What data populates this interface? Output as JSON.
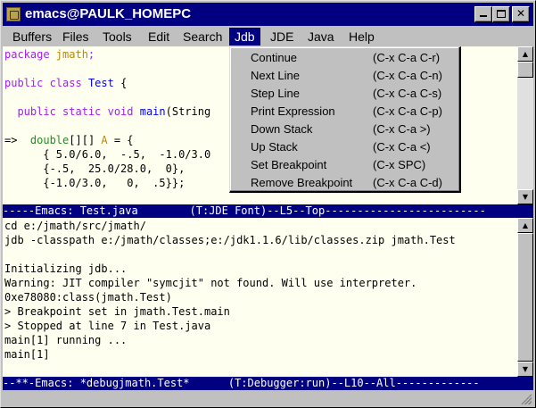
{
  "window": {
    "title": "emacs@PAULK_HOMEPC"
  },
  "menubar": {
    "items": [
      "Buffers",
      "Files",
      "Tools",
      "Edit",
      "Search",
      "Jdb",
      "JDE",
      "Java",
      "Help"
    ],
    "active": "Jdb"
  },
  "code_pane": {
    "lines": [
      "package jmath;",
      "",
      "public class Test {",
      "",
      "  public static void main(String",
      "",
      "=>  double[][] A = {",
      "      { 5.0/6.0,  -.5,  -1.0/3.0",
      "      {-.5,  25.0/28.0,  0},",
      "      {-1.0/3.0,   0,  .5}};"
    ]
  },
  "modeline_top": {
    "text": "-----Emacs: Test.java        (T:JDE Font)--L5--Top-------------------------"
  },
  "debug_pane": {
    "lines": [
      "cd e:/jmath/src/jmath/",
      "jdb -classpath e:/jmath/classes;e:/jdk1.1.6/lib/classes.zip jmath.Test",
      "",
      "Initializing jdb...",
      "Warning: JIT compiler \"symcjit\" not found. Will use interpreter.",
      "0xe78080:class(jmath.Test)",
      "> Breakpoint set in jmath.Test.main",
      "> Stopped at line 7 in Test.java",
      "main[1] running ...",
      "main[1]"
    ]
  },
  "modeline_bottom": {
    "text": "--**-Emacs: *debugjmath.Test*      (T:Debugger:run)--L10--All-------------"
  },
  "jdb_menu": {
    "items": [
      {
        "label": "Continue",
        "shortcut": "(C-x C-a C-r)"
      },
      {
        "label": "Next Line",
        "shortcut": "(C-x C-a C-n)"
      },
      {
        "label": "Step Line",
        "shortcut": "(C-x C-a C-s)"
      },
      {
        "label": "Print Expression",
        "shortcut": "(C-x C-a C-p)"
      },
      {
        "label": "Down Stack",
        "shortcut": "(C-x C-a >)"
      },
      {
        "label": "Up Stack",
        "shortcut": "(C-x C-a <)"
      },
      {
        "label": "Set Breakpoint",
        "shortcut": "(C-x SPC)"
      },
      {
        "label": "Remove Breakpoint",
        "shortcut": "(C-x C-a C-d)"
      }
    ]
  },
  "icons": {
    "title": "emacs-app-icon",
    "minimize": "minimize-icon",
    "maximize": "maximize-icon",
    "close": "close-icon",
    "scroll_up": "triangle-up-icon",
    "scroll_down": "triangle-down-icon"
  },
  "colors": {
    "titlebar": "#000080",
    "modeline": "#000080",
    "buffer_bg": "#fffff0",
    "keyword": "#a020f0",
    "function": "#0000ff",
    "variable": "#b8860b",
    "arrow_marker": "#228b22"
  }
}
